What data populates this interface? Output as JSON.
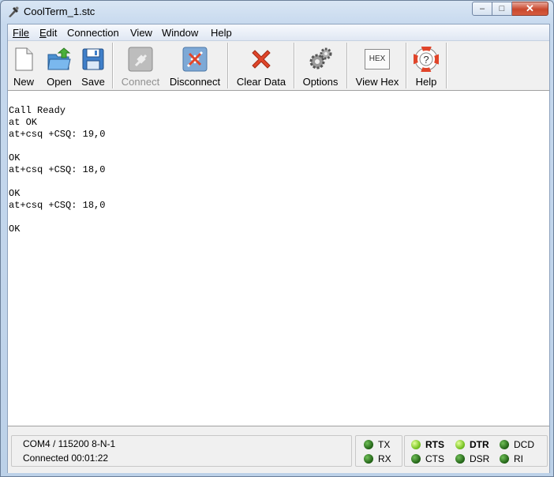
{
  "window": {
    "title": "CoolTerm_1.stc"
  },
  "menu": [
    "File",
    "Edit",
    "Connection",
    "View",
    "Window",
    "Help"
  ],
  "toolbar": {
    "new": "New",
    "open": "Open",
    "save": "Save",
    "connect": "Connect",
    "disconnect": "Disconnect",
    "clear": "Clear Data",
    "options": "Options",
    "viewhex": "View Hex",
    "hex_icon_text": "HEX",
    "help": "Help"
  },
  "terminal": {
    "text": "Call Ready\nat OK\nat+csq +CSQ: 19,0\n\nOK\nat+csq +CSQ: 18,0\n\nOK\nat+csq +CSQ: 18,0\n\nOK"
  },
  "status": {
    "port": "COM4 / 115200 8-N-1",
    "connected": "Connected 00:01:22",
    "leds": {
      "tx": "TX",
      "rx": "RX",
      "rts": "RTS",
      "cts": "CTS",
      "dtr": "DTR",
      "dsr": "DSR",
      "dcd": "DCD",
      "ri": "RI"
    },
    "active": [
      "RTS",
      "DTR"
    ]
  },
  "colors": {
    "led_on": "#7cc627",
    "led_off": "#1f5f14",
    "disconnect_accent": "#e0452a"
  }
}
